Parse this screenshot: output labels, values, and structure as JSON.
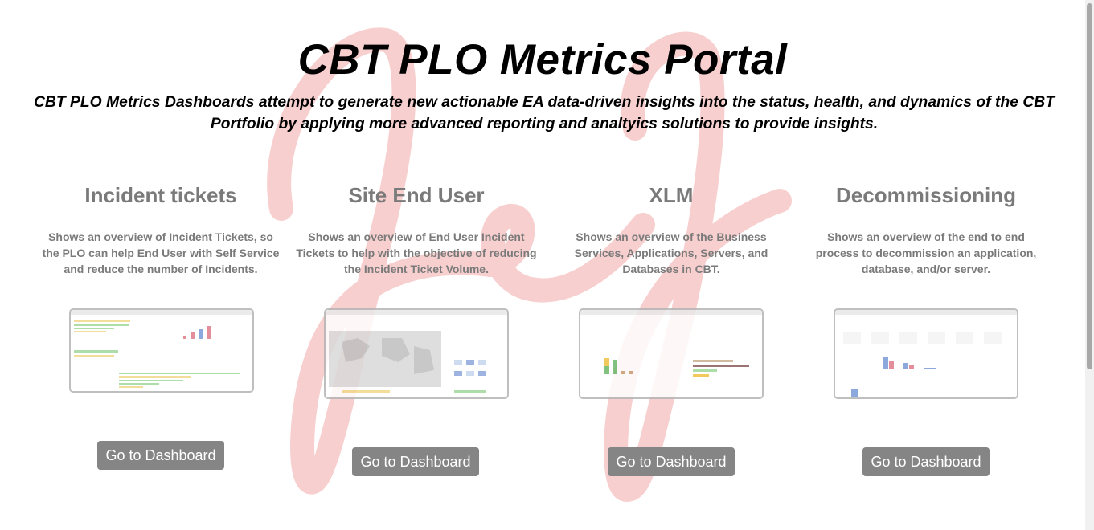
{
  "header": {
    "title": "CBT PLO Metrics Portal",
    "subtitle": "CBT PLO Metrics Dashboards attempt to generate new actionable EA data-driven insights into the status, health, and dynamics of the CBT Portfolio by applying more advanced reporting and analtyics solutions to provide insights."
  },
  "cards": [
    {
      "title": "Incident tickets",
      "description": "Shows an overview of Incident Tickets, so the PLO can help End User with Self Service and reduce the number of Incidents.",
      "button": "Go to Dashboard"
    },
    {
      "title": "Site End User",
      "description": "Shows an overview of End User Incident Tickets to help with the objective of reducing the Incident Ticket Volume.",
      "button": "Go to Dashboard"
    },
    {
      "title": "XLM",
      "description": "Shows an overview of the Business Services, Applications, Servers, and Databases in CBT.",
      "button": "Go to Dashboard"
    },
    {
      "title": "Decommissioning",
      "description": "Shows an overview of the end to end process to decommission an application, database, and/or server.",
      "button": "Go to Dashboard"
    }
  ],
  "colors": {
    "watermark": "#f7c9c9",
    "heading": "#7a7a7a",
    "button": "#858585"
  }
}
